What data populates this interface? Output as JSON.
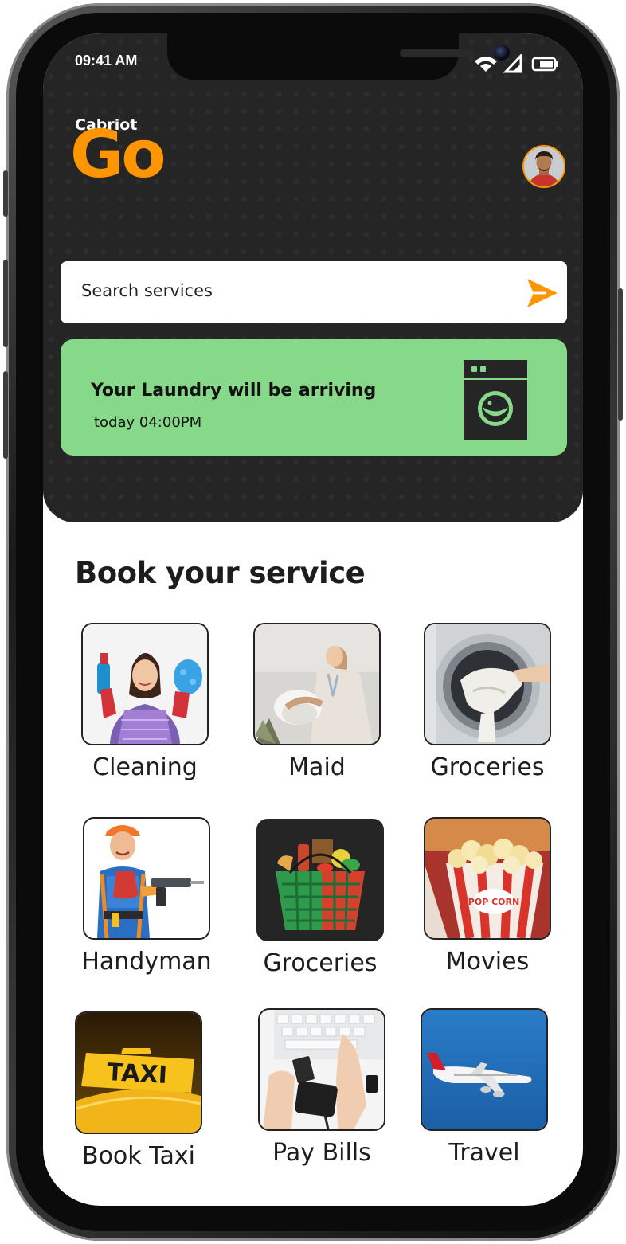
{
  "status_bar": {
    "time": "09:41 AM"
  },
  "brand": {
    "small": "Cabriot",
    "large": "Go"
  },
  "search": {
    "placeholder": "Search services"
  },
  "banner": {
    "title": "Your Laundry will be arriving",
    "subtitle": "today 04:00PM",
    "bg_color": "#86d988"
  },
  "section": {
    "title": "Book your service"
  },
  "services": [
    {
      "label": "Cleaning"
    },
    {
      "label": "Maid"
    },
    {
      "label": "Groceries"
    },
    {
      "label": "Handyman"
    },
    {
      "label": "Groceries"
    },
    {
      "label": "Movies"
    },
    {
      "label": "Book Taxi"
    },
    {
      "label": "Pay Bills"
    },
    {
      "label": "Travel"
    }
  ],
  "taxi_sign": "TAXI",
  "popcorn_text": "POP CORN",
  "colors": {
    "accent": "#ff9500",
    "header_bg": "#252525",
    "banner": "#86d988"
  }
}
